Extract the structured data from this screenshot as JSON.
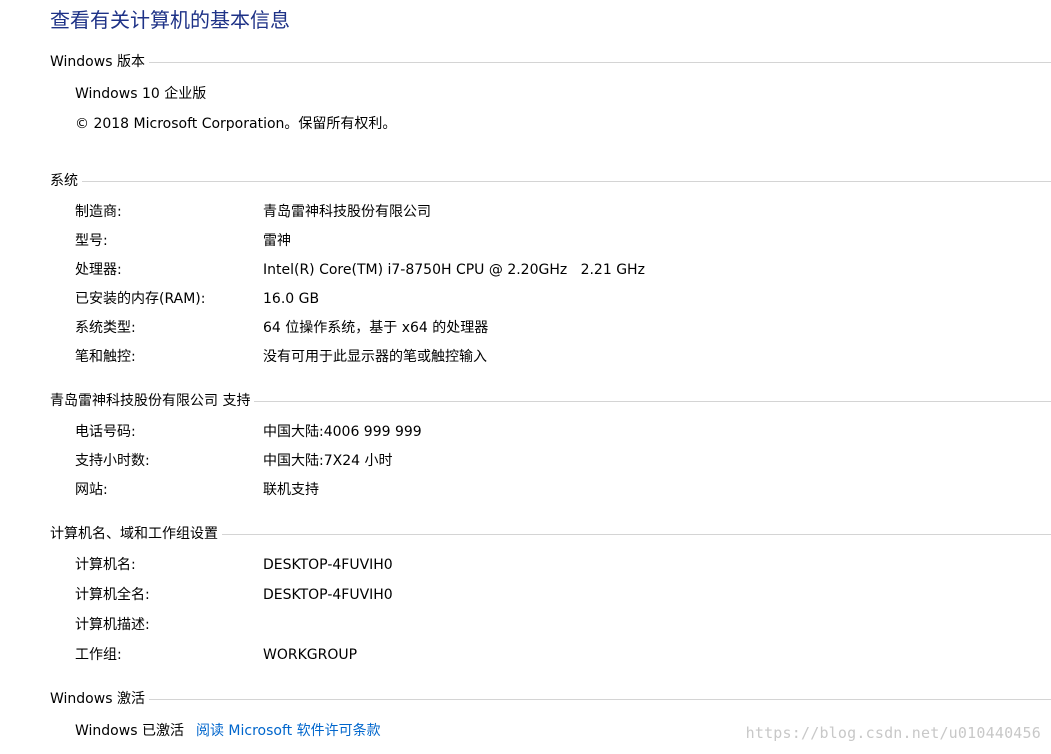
{
  "page_title": "查看有关计算机的基本信息",
  "edition": {
    "header": "Windows 版本",
    "name": "Windows 10 企业版",
    "copyright": "© 2018 Microsoft Corporation。保留所有权利。"
  },
  "system": {
    "header": "系统",
    "rows": [
      {
        "label": "制造商:",
        "value": "青岛雷神科技股份有限公司"
      },
      {
        "label": "型号:",
        "value": "雷神"
      },
      {
        "label": "处理器:",
        "value": "Intel(R) Core(TM) i7-8750H CPU @ 2.20GHz   2.21 GHz"
      },
      {
        "label": "已安装的内存(RAM):",
        "value": "16.0 GB"
      },
      {
        "label": "系统类型:",
        "value": "64 位操作系统，基于 x64 的处理器"
      },
      {
        "label": "笔和触控:",
        "value": "没有可用于此显示器的笔或触控输入"
      }
    ]
  },
  "support": {
    "header": "青岛雷神科技股份有限公司 支持",
    "rows": [
      {
        "label": "电话号码:",
        "value": "中国大陆:4006 999 999"
      },
      {
        "label": "支持小时数:",
        "value": "中国大陆:7X24 小时"
      },
      {
        "label": "网站:",
        "value": "联机支持"
      }
    ]
  },
  "computer": {
    "header": "计算机名、域和工作组设置",
    "rows": [
      {
        "label": "计算机名:",
        "value": "DESKTOP-4FUVIH0"
      },
      {
        "label": "计算机全名:",
        "value": "DESKTOP-4FUVIH0"
      },
      {
        "label": "计算机描述:",
        "value": ""
      },
      {
        "label": "工作组:",
        "value": "WORKGROUP"
      }
    ]
  },
  "activation": {
    "header": "Windows 激活",
    "status": "Windows 已激活",
    "license_link": "阅读 Microsoft 软件许可条款"
  },
  "watermark": "https://blog.csdn.net/u010440456",
  "colors": {
    "title": "#1e3287",
    "link": "#0066cc",
    "divider": "#d4d4d4"
  }
}
